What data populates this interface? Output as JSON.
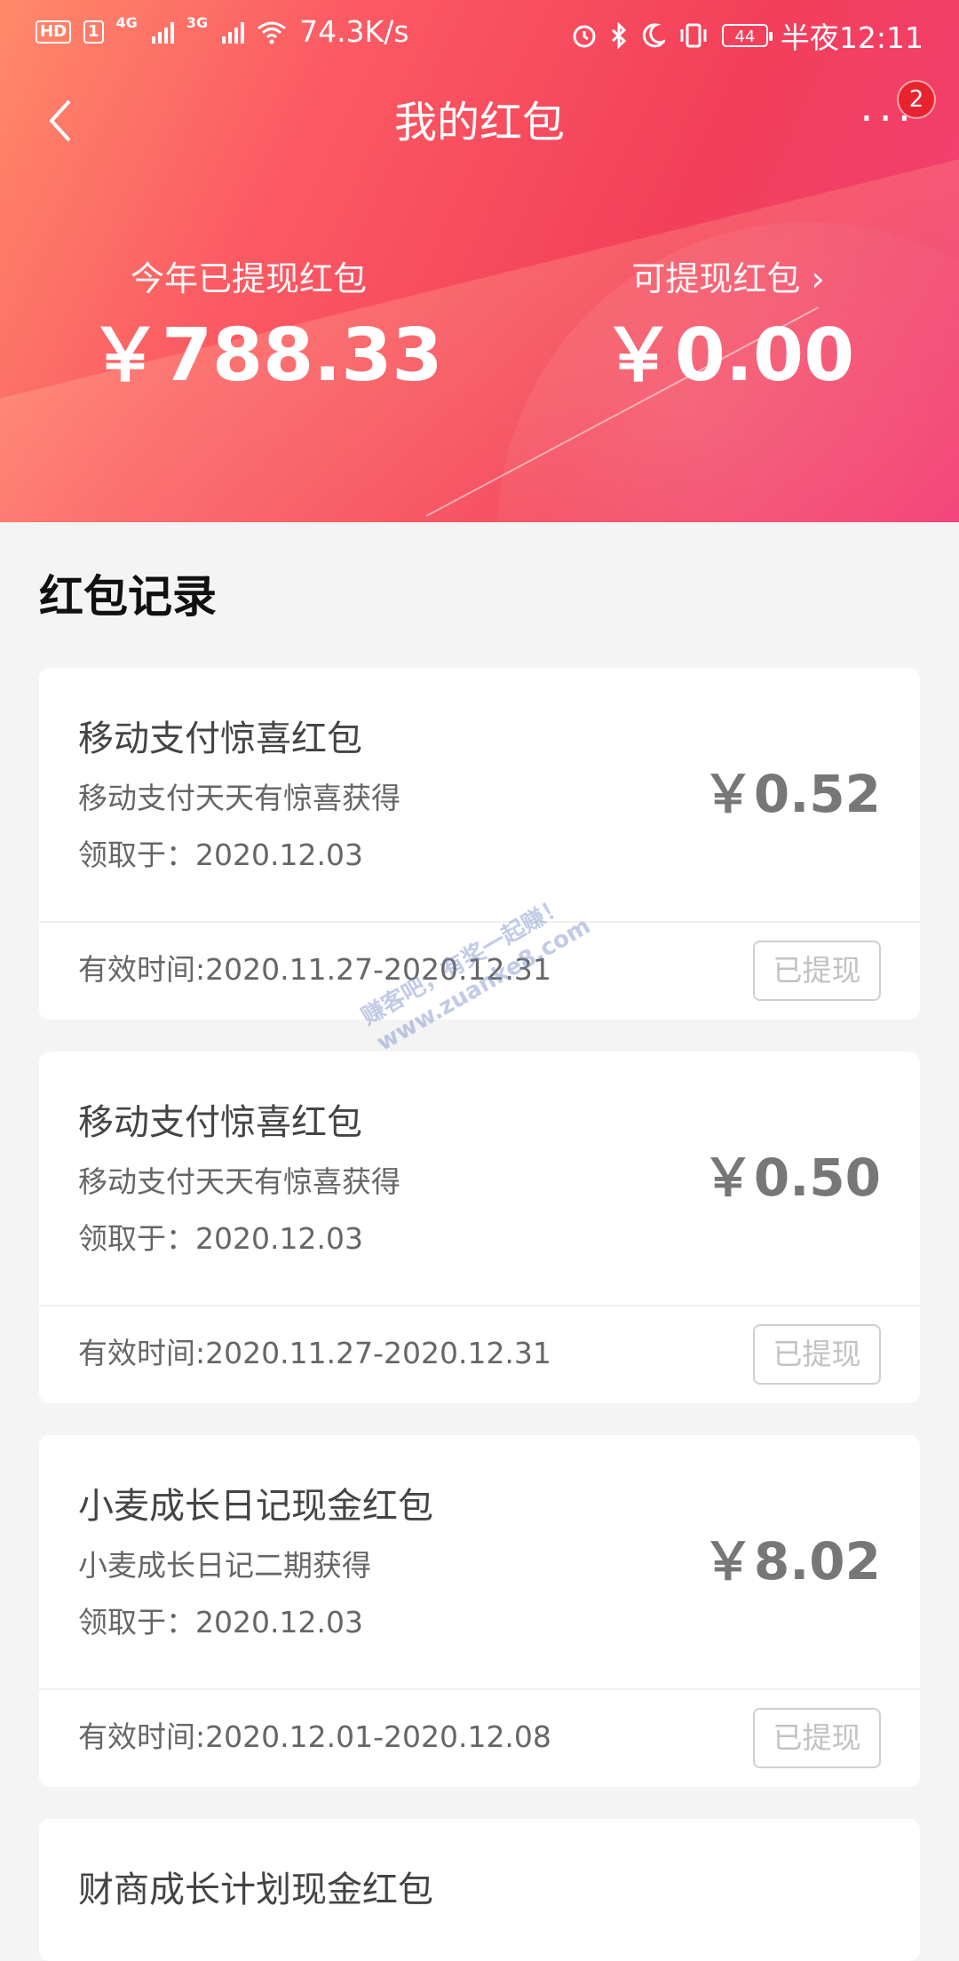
{
  "status_bar": {
    "hd": "HD",
    "sim1": "1",
    "net1": "4G",
    "net2": "3G",
    "speed": "74.3K/s",
    "battery": "44",
    "time": "半夜12:11"
  },
  "nav": {
    "title": "我的红包",
    "more": "···",
    "badge": "2"
  },
  "summary": {
    "withdrawn_label": "今年已提现红包",
    "withdrawn_amount": "￥788.33",
    "available_label": "可提现红包 ›",
    "available_amount": "￥0.00"
  },
  "records": {
    "title": "红包记录",
    "items": [
      {
        "name": "移动支付惊喜红包",
        "source": "移动支付天天有惊喜获得",
        "received": "领取于：2020.12.03",
        "amount": "￥0.52",
        "valid": "有效时间:2020.11.27-2020.12.31",
        "status": "已提现"
      },
      {
        "name": "移动支付惊喜红包",
        "source": "移动支付天天有惊喜获得",
        "received": "领取于：2020.12.03",
        "amount": "￥0.50",
        "valid": "有效时间:2020.11.27-2020.12.31",
        "status": "已提现"
      },
      {
        "name": "小麦成长日记现金红包",
        "source": "小麦成长日记二期获得",
        "received": "领取于：2020.12.03",
        "amount": "￥8.02",
        "valid": "有效时间:2020.12.01-2020.12.08",
        "status": "已提现"
      },
      {
        "name": "财商成长计划现金红包"
      }
    ]
  },
  "watermark": {
    "line1": "赚客吧，有奖一起赚！",
    "line2": "www.zuanke8.com"
  },
  "colors": {
    "header_start": "#ff8a6a",
    "header_end": "#f23f78",
    "badge": "#e8232f"
  }
}
